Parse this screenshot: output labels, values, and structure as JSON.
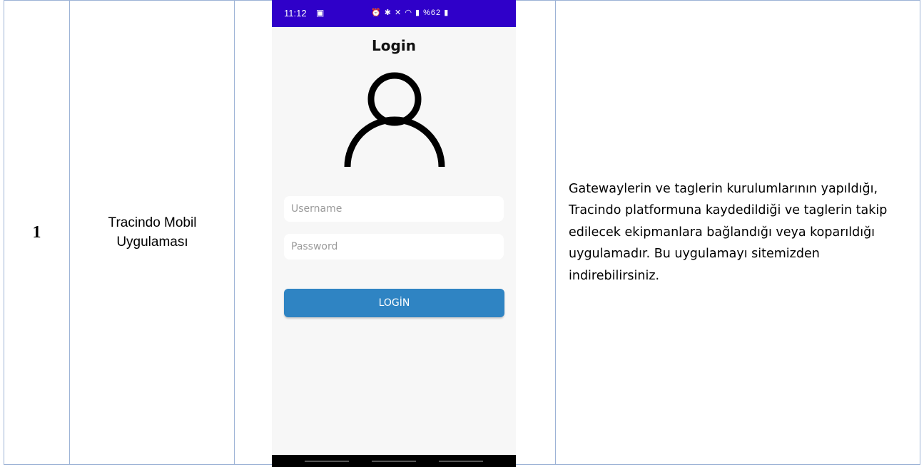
{
  "table": {
    "row": {
      "number": "1",
      "app_name_line1": "Tracindo Mobil",
      "app_name_line2": "Uygulaması",
      "description": "Gatewaylerin ve taglerin kurulumlarının ya­pıldığı, Tracindo platformuna kaydedildiği ve taglerin takip edilecek ekipmanlara bağlan­dığı veya koparıldığı uygulamadır. Bu uygu­lamayı sitemizden indirebilirsiniz."
    }
  },
  "phone": {
    "status_bar": {
      "time": "11:12",
      "notification_icon": "gallery-icon",
      "battery_text": "%62",
      "color": "#2f00c9"
    },
    "title": "Login",
    "avatar_icon": "user-icon",
    "username_placeholder": "Username",
    "password_placeholder": "Password",
    "login_button_label": "LOGİN",
    "button_color": "#2f84c3"
  }
}
